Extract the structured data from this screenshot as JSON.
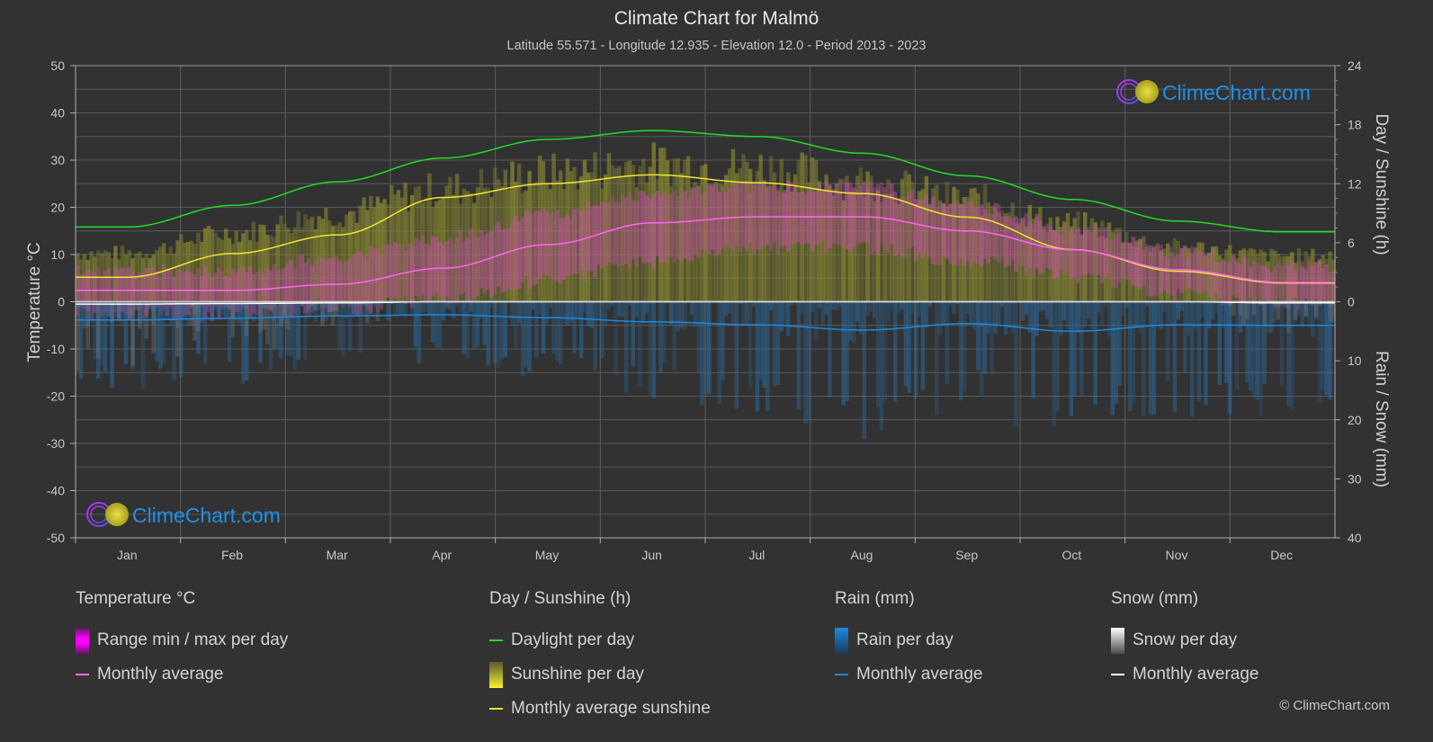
{
  "header": {
    "title": "Climate Chart for Malmö",
    "subtitle": "Latitude 55.571 - Longitude 12.935 - Elevation 12.0 - Period 2013 - 2023"
  },
  "logo": {
    "text": "ClimeChart.com"
  },
  "copyright": "© ClimeChart.com",
  "colors": {
    "background": "#323232",
    "temp_avg": "#ff66ee",
    "temp_range": "#e020e0",
    "sunshine_avg": "#f0e630",
    "sunshine_fill": "#8a8a30",
    "daylight": "#22dd22",
    "rain_avg": "#1a8ae0",
    "rain_fill": "#1e5a8a",
    "snow_avg": "#ffffff",
    "snow_fill": "#8a8a8a",
    "logo_text": "#1e90e8"
  },
  "legend": {
    "temperature": {
      "title": "Temperature °C",
      "range": "Range min / max per day",
      "avg": "Monthly average"
    },
    "sunshine": {
      "title": "Day / Sunshine (h)",
      "daylight": "Daylight per day",
      "sunshine": "Sunshine per day",
      "avg": "Monthly average sunshine"
    },
    "rain": {
      "title": "Rain (mm)",
      "per_day": "Rain per day",
      "avg": "Monthly average"
    },
    "snow": {
      "title": "Snow (mm)",
      "per_day": "Snow per day",
      "avg": "Monthly average"
    }
  },
  "chart_data": {
    "type": "line",
    "title": "Climate Chart for Malmö",
    "subtitle": "Latitude 55.571 - Longitude 12.935 - Elevation 12.0 - Period 2013 - 2023",
    "categories": [
      "Jan",
      "Feb",
      "Mar",
      "Apr",
      "May",
      "Jun",
      "Jul",
      "Aug",
      "Sep",
      "Oct",
      "Nov",
      "Dec"
    ],
    "y_left": {
      "label": "Temperature °C",
      "range": [
        -50,
        50
      ],
      "ticks": [
        50,
        40,
        30,
        20,
        10,
        0,
        -10,
        -20,
        -30,
        -40,
        -50
      ]
    },
    "y_right_top": {
      "label": "Day / Sunshine (h)",
      "range": [
        0,
        24
      ],
      "ticks": [
        24,
        18,
        12,
        6,
        0
      ]
    },
    "y_right_bottom": {
      "label": "Rain / Snow (mm)",
      "range": [
        0,
        40
      ],
      "ticks": [
        10,
        20,
        30,
        40
      ]
    },
    "grid": true,
    "legend_position": "bottom",
    "series": [
      {
        "name": "Temperature monthly average",
        "axis": "temperature",
        "unit": "°C",
        "values": [
          2.4,
          2.4,
          3.7,
          7.1,
          12.1,
          16.7,
          18.0,
          18.0,
          15.0,
          11.0,
          6.8,
          4.1
        ]
      },
      {
        "name": "Temperature daily min (approx.)",
        "axis": "temperature",
        "unit": "°C",
        "values": [
          -1,
          -1,
          0,
          2,
          6,
          10,
          13,
          13,
          10,
          7,
          3,
          1
        ]
      },
      {
        "name": "Temperature daily max (approx.)",
        "axis": "temperature",
        "unit": "°C",
        "values": [
          5,
          5,
          8,
          12,
          17,
          21,
          23,
          23,
          19,
          14,
          9,
          6
        ]
      },
      {
        "name": "Daylight per day",
        "axis": "sunshine",
        "unit": "h",
        "values": [
          7.6,
          9.8,
          12.2,
          14.6,
          16.5,
          17.4,
          16.8,
          15.1,
          12.8,
          10.4,
          8.2,
          7.1
        ]
      },
      {
        "name": "Sunshine per day (max envelope approx.)",
        "axis": "sunshine",
        "unit": "h",
        "values": [
          5.5,
          7.8,
          10.0,
          12.7,
          14.5,
          15.6,
          15.2,
          13.6,
          11.6,
          8.8,
          6.2,
          5.2
        ]
      },
      {
        "name": "Monthly average sunshine",
        "axis": "sunshine",
        "unit": "h",
        "values": [
          2.5,
          4.9,
          6.8,
          10.6,
          12.0,
          12.9,
          12.1,
          11.0,
          8.6,
          5.3,
          3.1,
          1.9
        ]
      },
      {
        "name": "Rain monthly average",
        "axis": "rain",
        "unit": "mm",
        "values": [
          3.1,
          2.8,
          2.4,
          2.2,
          2.7,
          3.4,
          3.9,
          4.8,
          3.7,
          5.0,
          3.9,
          4.0
        ]
      },
      {
        "name": "Snow monthly average",
        "axis": "rain",
        "unit": "mm",
        "values": [
          0.4,
          0.3,
          0.2,
          0.0,
          0.0,
          0.0,
          0.0,
          0.0,
          0.0,
          0.0,
          0.0,
          0.2
        ]
      }
    ]
  }
}
